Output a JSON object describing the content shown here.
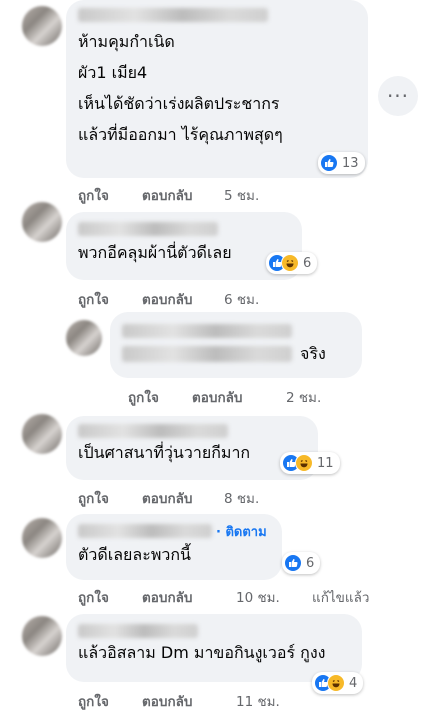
{
  "colors": {
    "bubble": "#f0f2f5",
    "meta": "#65676b",
    "link": "#1877f2",
    "like": "#1877f2",
    "haha": "#f7b928"
  },
  "icons": {
    "like": "like-reaction-icon",
    "haha": "haha-reaction-icon",
    "more": "more-options-icon"
  },
  "more_label": "···",
  "comments": [
    {
      "lines": [
        "ห้ามคุมกำเนิด",
        "ผัว1 เมีย4",
        "เห็นได้ชัดว่าเร่งผลิตประชากร",
        "แล้วที่มีออกมา ไร้คุณภาพสุดๆ"
      ],
      "reactions": "13",
      "like": "ถูกใจ",
      "reply": "ตอบกลับ",
      "time": "5 ชม."
    },
    {
      "lines": [
        "พวกอีคลุมผ้านี่ตัวดีเลย"
      ],
      "reactions": "6",
      "like": "ถูกใจ",
      "reply": "ตอบกลับ",
      "time": "6 ชม."
    },
    {
      "lines": [
        "จริง"
      ],
      "like": "ถูกใจ",
      "reply": "ตอบกลับ",
      "time": "2 ชม."
    },
    {
      "lines": [
        "เป็นศาสนาที่วุ่นวายกีมาก"
      ],
      "reactions": "11",
      "like": "ถูกใจ",
      "reply": "ตอบกลับ",
      "time": "8 ชม."
    },
    {
      "follow": "· ติดตาม",
      "lines": [
        "ตัวดีเลยละพวกนี้"
      ],
      "reactions": "6",
      "like": "ถูกใจ",
      "reply": "ตอบกลับ",
      "time": "10 ชม.",
      "edited": "แก้ไขแล้ว"
    },
    {
      "lines": [
        "แล้วอิสลาม Dm มาขอกินงูเวอร์ กูงง"
      ],
      "reactions": "4",
      "like": "ถูกใจ",
      "reply": "ตอบกลับ",
      "time": "11 ชม."
    }
  ]
}
